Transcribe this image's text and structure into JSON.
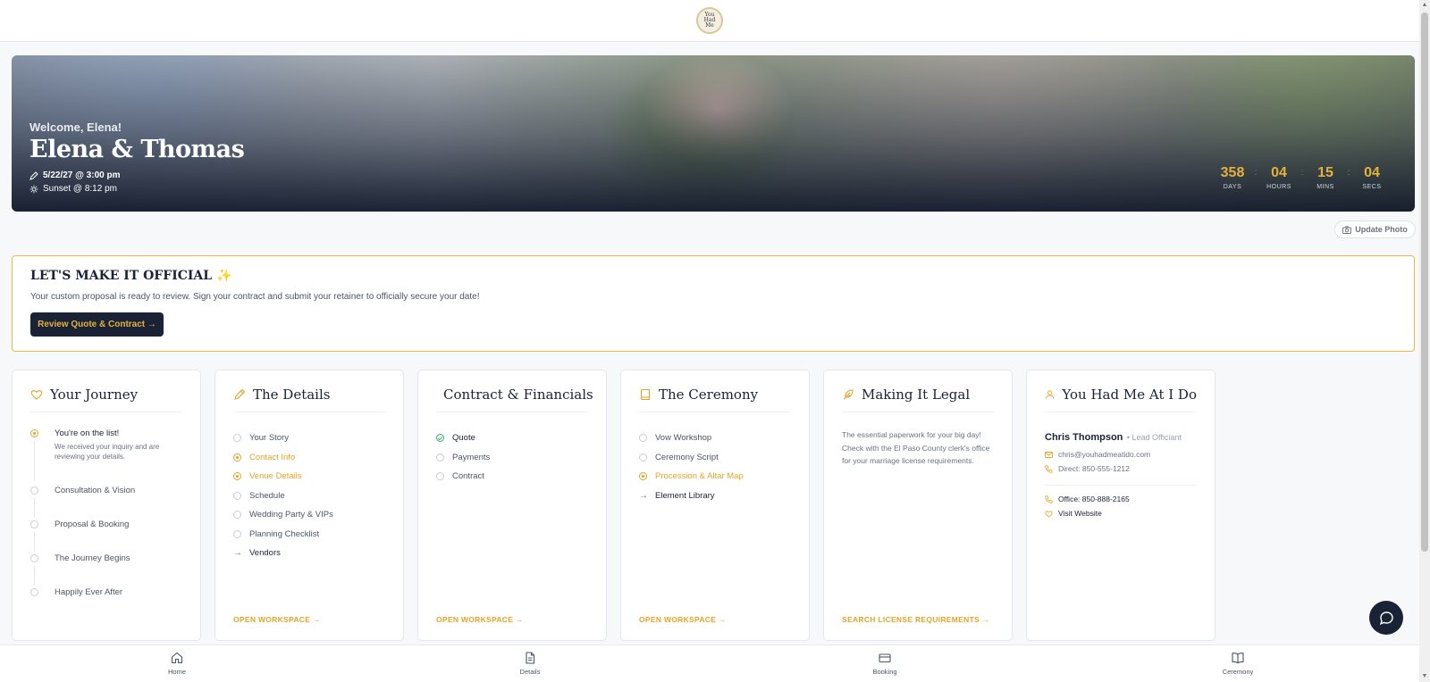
{
  "header": {
    "logo_text": "You Had Me At I Do"
  },
  "hero": {
    "welcome": "Welcome, Elena!",
    "couple": "Elena & Thomas",
    "date_time": "5/22/27 @ 3:00 pm",
    "sunset": "Sunset @ 8:12 pm",
    "countdown": [
      {
        "value": "358",
        "label": "DAYS"
      },
      {
        "value": "04",
        "label": "HOURS"
      },
      {
        "value": "15",
        "label": "MINS"
      },
      {
        "value": "04",
        "label": "SECS"
      }
    ],
    "update_photo_label": "Update Photo"
  },
  "official": {
    "title": "LET'S MAKE IT OFFICIAL",
    "spark": "✨",
    "text": "Your custom proposal is ready to review. Sign your contract and submit your retainer to officially secure your date!",
    "button_label": "Review Quote & Contract →"
  },
  "journey": {
    "title": "Your Journey",
    "steps": [
      {
        "title": "You're on the list!",
        "desc": "We received your inquiry and are reviewing your details."
      },
      {
        "title": "Consultation & Vision"
      },
      {
        "title": "Proposal & Booking"
      },
      {
        "title": "The Journey Begins"
      },
      {
        "title": "Happily Ever After"
      }
    ]
  },
  "details": {
    "title": "The Details",
    "items": [
      "Your Story",
      "Contact Info",
      "Venue Details",
      "Schedule",
      "Wedding Party & VIPs",
      "Planning Checklist",
      "Vendors"
    ],
    "link": "OPEN WORKSPACE →"
  },
  "contract": {
    "title": "Contract & Financials",
    "items": [
      "Quote",
      "Payments",
      "Contract"
    ],
    "link": "OPEN WORKSPACE →"
  },
  "ceremony": {
    "title": "The Ceremony",
    "items": [
      "Vow Workshop",
      "Ceremony Script",
      "Procession & Altar Map",
      "Element Library"
    ],
    "link": "OPEN WORKSPACE →"
  },
  "legal": {
    "title": "Making It Legal",
    "text": "The essential paperwork for your big day! Check with the El Paso County clerk's office for your marriage license requirements.",
    "link": "SEARCH LICENSE REQUIREMENTS →"
  },
  "officiant": {
    "title": "You Had Me At I Do",
    "name": "Chris Thompson",
    "role": "• Lead Officiant",
    "email": "chris@youhadmeatido.com",
    "direct": "Direct: 850-555-1212",
    "office": "Office: 850-888-2165",
    "website": "Visit Website"
  },
  "bottom_nav": [
    {
      "label": "Home",
      "icon": "home-icon"
    },
    {
      "label": "Details",
      "icon": "document-icon"
    },
    {
      "label": "Booking",
      "icon": "card-icon"
    },
    {
      "label": "Ceremony",
      "icon": "book-icon"
    }
  ],
  "colors": {
    "navy": "#1a2236",
    "gold": "#e5b13e",
    "accent": "#e5a325",
    "success": "#39b36b"
  }
}
